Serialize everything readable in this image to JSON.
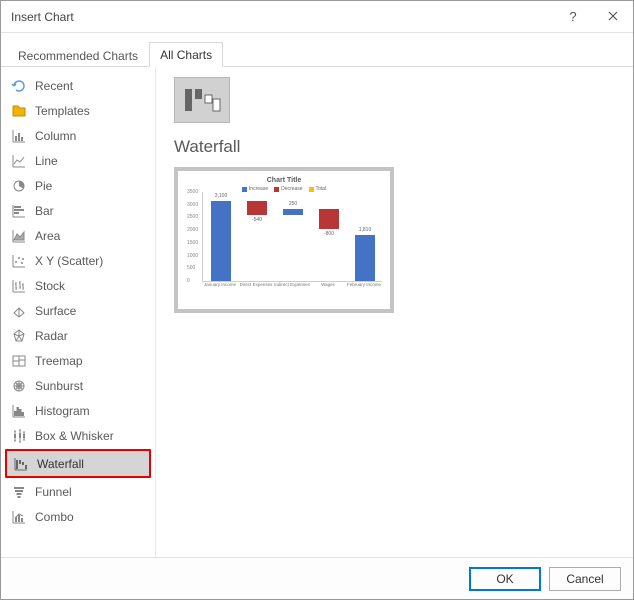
{
  "titlebar": {
    "title": "Insert Chart"
  },
  "tabs": {
    "recommended": "Recommended Charts",
    "all": "All Charts"
  },
  "sidebar": {
    "items": [
      {
        "label": "Recent"
      },
      {
        "label": "Templates"
      },
      {
        "label": "Column"
      },
      {
        "label": "Line"
      },
      {
        "label": "Pie"
      },
      {
        "label": "Bar"
      },
      {
        "label": "Area"
      },
      {
        "label": "X Y (Scatter)"
      },
      {
        "label": "Stock"
      },
      {
        "label": "Surface"
      },
      {
        "label": "Radar"
      },
      {
        "label": "Treemap"
      },
      {
        "label": "Sunburst"
      },
      {
        "label": "Histogram"
      },
      {
        "label": "Box & Whisker"
      },
      {
        "label": "Waterfall"
      },
      {
        "label": "Funnel"
      },
      {
        "label": "Combo"
      }
    ]
  },
  "main": {
    "heading": "Waterfall",
    "preview_title": "Chart Title",
    "legend": {
      "increase": "Increase",
      "decrease": "Decrease",
      "total": "Total"
    }
  },
  "footer": {
    "ok": "OK",
    "cancel": "Cancel"
  },
  "colors": {
    "increase": "#4472c4",
    "decrease": "#b93636",
    "total": "#ffc000"
  },
  "chart_data": {
    "type": "waterfall",
    "title": "Chart Title",
    "categories": [
      "January Income",
      "Direct Expenses",
      "Indirect Expenses",
      "Wages",
      "February Income"
    ],
    "values": [
      3100,
      -540,
      250,
      -800,
      1810
    ],
    "labels": [
      "3,100",
      "-540",
      "250",
      "-800",
      "1,810"
    ],
    "ylim": [
      0,
      3500
    ],
    "yticks": [
      0,
      500,
      1000,
      1500,
      2000,
      2500,
      3000,
      3500
    ],
    "legend": [
      "Increase",
      "Decrease",
      "Total"
    ]
  }
}
